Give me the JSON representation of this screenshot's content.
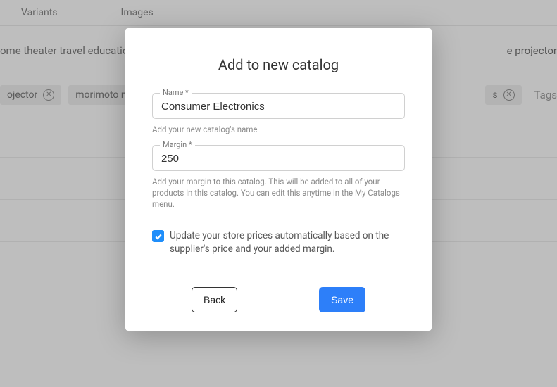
{
  "bg": {
    "tabs": {
      "variants": "Variants",
      "images": "Images"
    },
    "description": "ome theater travel education",
    "proj_right": "e projector",
    "tag1": "ojector",
    "tag2": "morimoto mini",
    "tag_r": "s",
    "tags_label": "Tags"
  },
  "modal": {
    "title": "Add to new catalog",
    "name_label": "Name *",
    "name_value": "Consumer Electronics",
    "name_hint": "Add your new catalog's name",
    "margin_label": "Margin *",
    "margin_value": "250",
    "margin_hint": "Add your margin to this catalog. This will be added to all of your products in this catalog. You can edit this anytime in the My Catalogs menu.",
    "checkbox_label": "Update your store prices automatically based on the supplier's price and your added margin.",
    "back": "Back",
    "save": "Save"
  }
}
